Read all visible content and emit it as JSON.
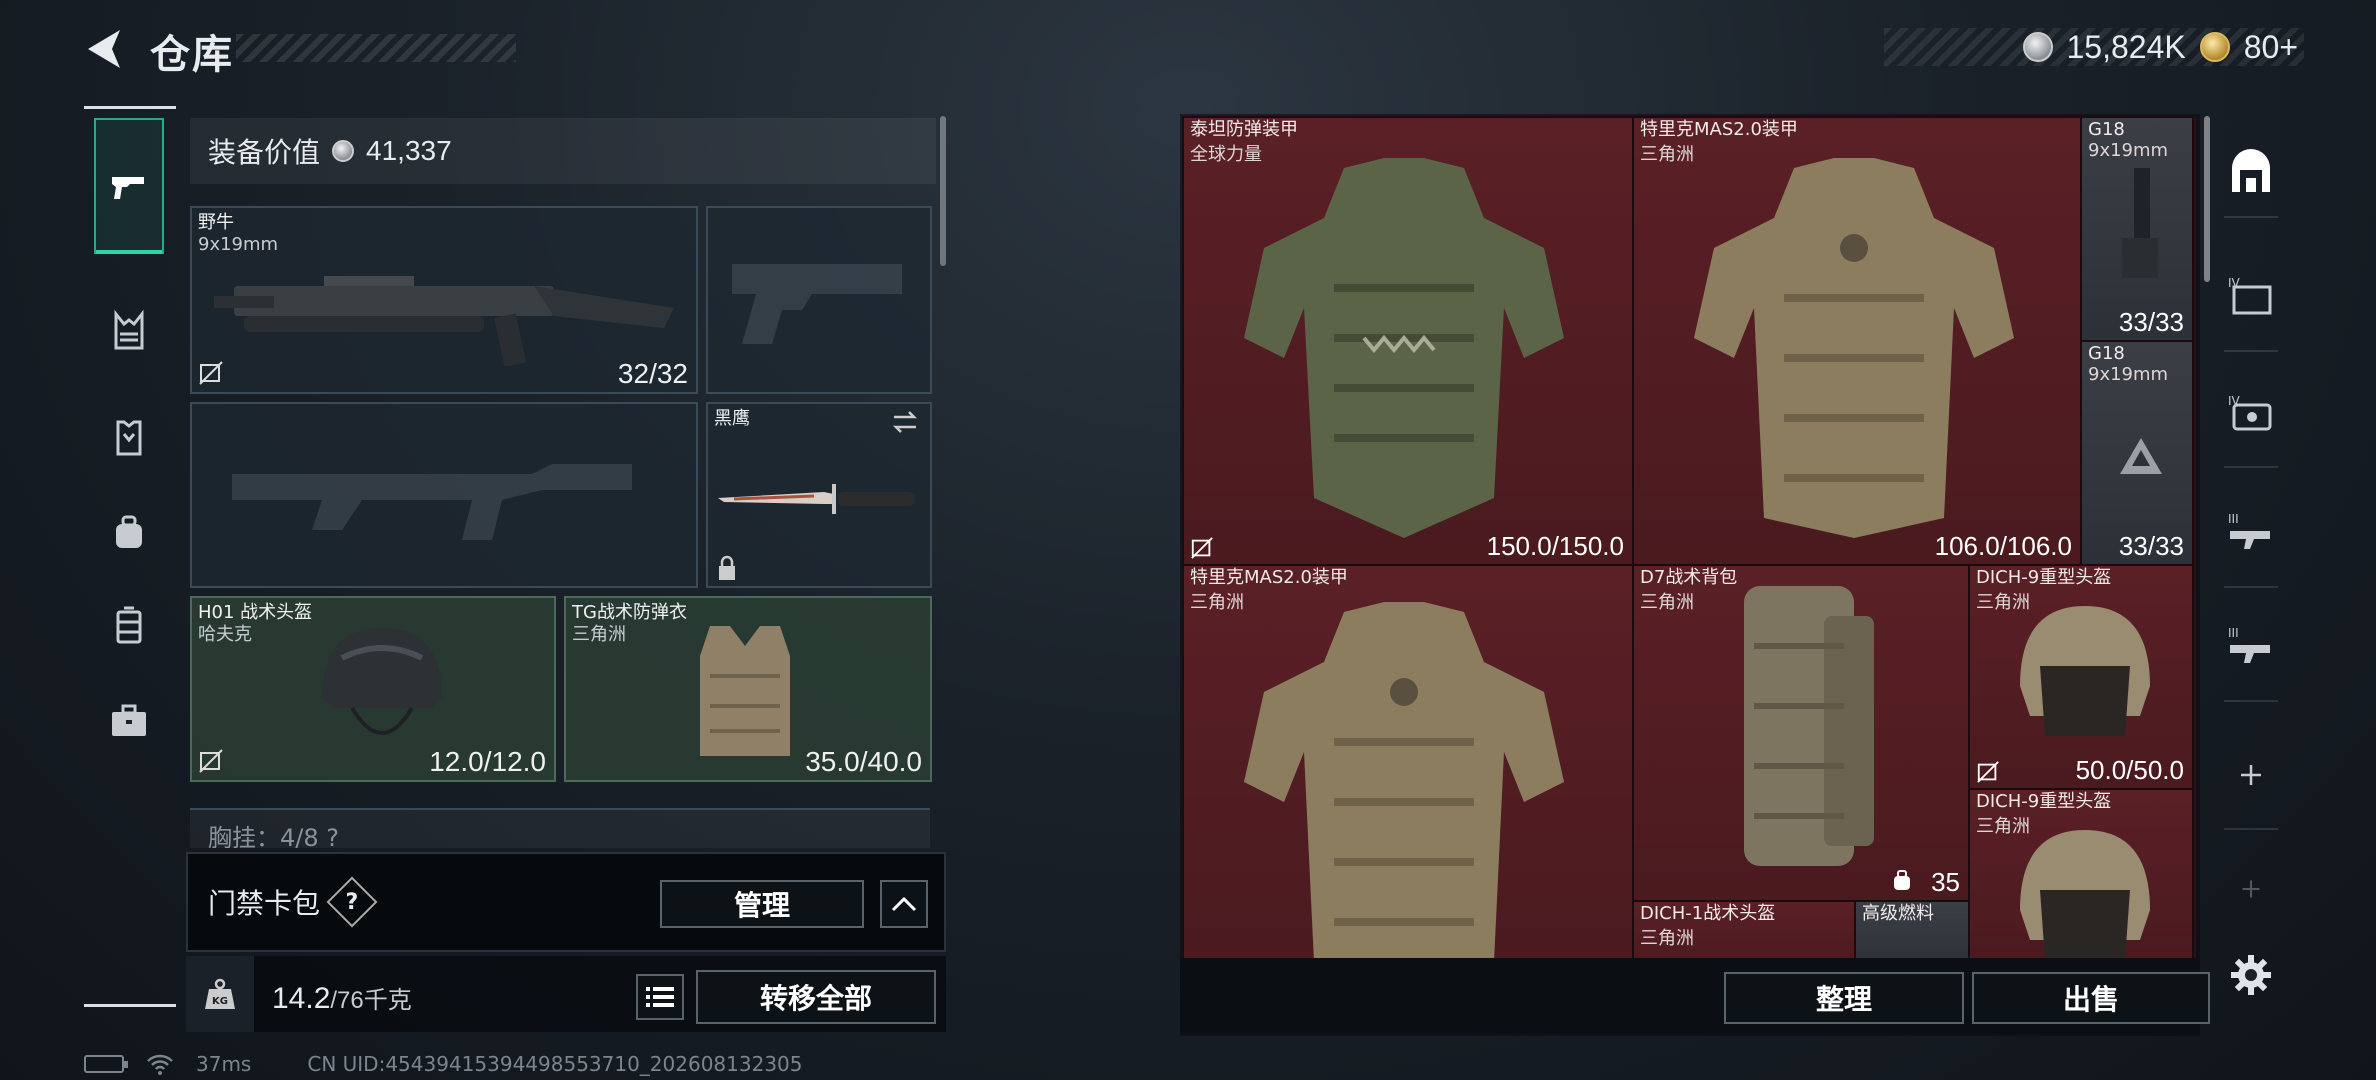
{
  "header": {
    "title": "仓库",
    "silver": "15,824K",
    "gold": "80+"
  },
  "nav": {
    "items": [
      "weapons",
      "chest-rig",
      "armor",
      "backpack",
      "container",
      "case"
    ]
  },
  "loadout": {
    "value_label": "装备价值",
    "value": "41,337",
    "primary": {
      "name": "野牛",
      "caliber": "9x19mm",
      "durability": "32/32"
    },
    "knife": {
      "name": "黑鹰"
    },
    "helmet": {
      "name": "H01 战术头盔",
      "brand": "哈夫克",
      "durability": "12.0/12.0"
    },
    "armor": {
      "name": "TG战术防弹衣",
      "brand": "三角洲",
      "durability": "35.0/40.0"
    },
    "chest_label": "胸挂：4/8 ?",
    "keycard_label": "门禁卡包",
    "keycard_help": "?",
    "manage_label": "管理",
    "weight_current": "14.2",
    "weight_cap": "/76千克",
    "transfer_label": "转移全部"
  },
  "stash": {
    "items": [
      {
        "name": "泰坦防弹装甲",
        "brand": "全球力量",
        "value": "150.0/150.0"
      },
      {
        "name": "特里克MAS2.0装甲",
        "brand": "三角洲",
        "value": "106.0/106.0"
      },
      {
        "name": "G18",
        "brand": "9x19mm",
        "value": "33/33"
      },
      {
        "name": "G18",
        "brand": "9x19mm",
        "value": "33/33"
      },
      {
        "name": "特里克MAS2.0装甲",
        "brand": "三角洲",
        "value": ""
      },
      {
        "name": "D7战术背包",
        "brand": "三角洲",
        "value": "35"
      },
      {
        "name": "DICH-9重型头盔",
        "brand": "三角洲",
        "value": "50.0/50.0"
      },
      {
        "name": "DICH-9重型头盔",
        "brand": "三角洲",
        "value": ""
      },
      {
        "name": "DICH-1战术头盔",
        "brand": "三角洲",
        "value": ""
      },
      {
        "name": "高级燃料",
        "brand": "",
        "value": ""
      }
    ],
    "sort_label": "整理",
    "sell_label": "出售"
  },
  "status": {
    "ping": "37ms",
    "uid": "CN UID:45439415394498553710_202608132305"
  },
  "colors": {
    "accent": "#2fd3a6",
    "cell_red": "#4a1a1f",
    "cell_green": "#2a3e34"
  }
}
